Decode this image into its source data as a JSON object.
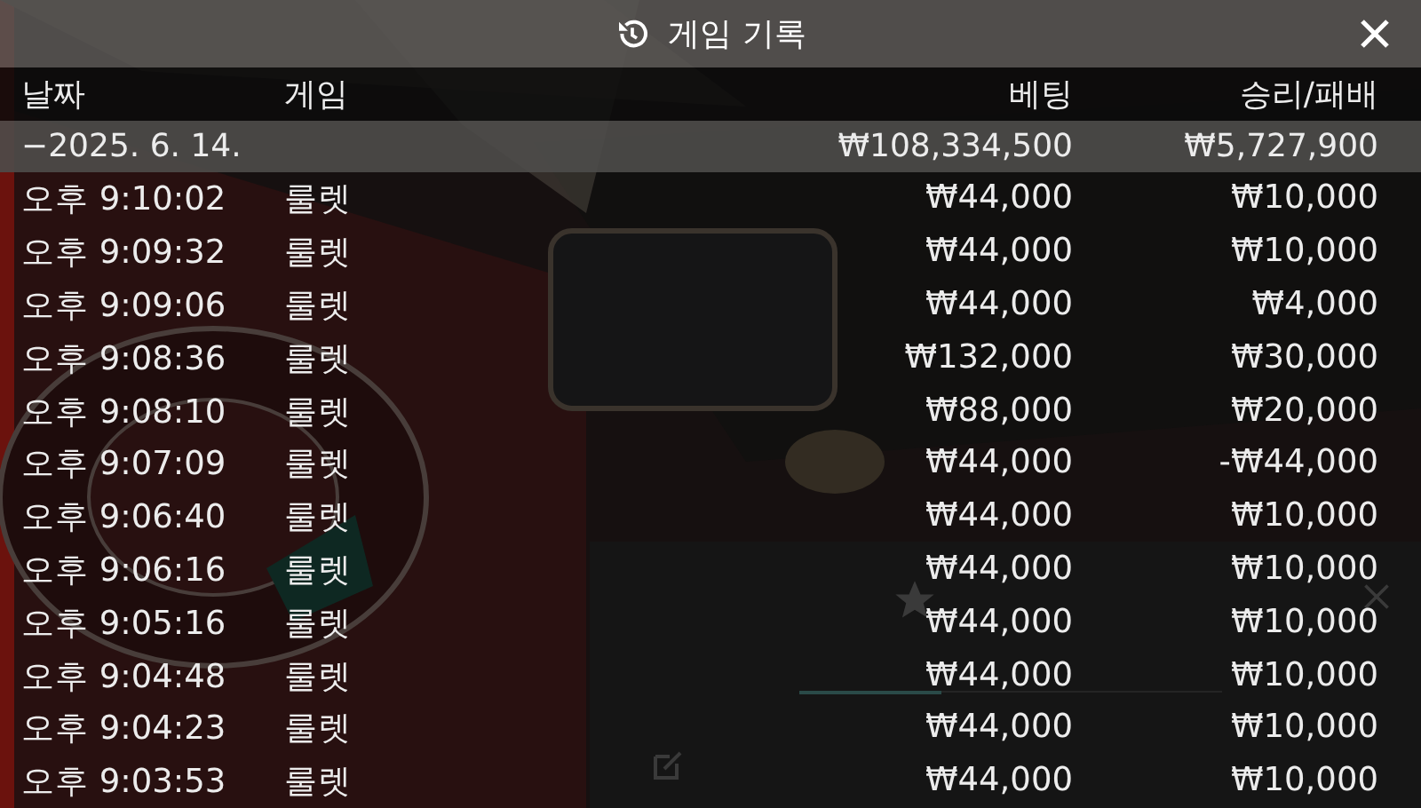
{
  "history": {
    "title": "게임 기록",
    "columns": [
      "날짜",
      "게임",
      "베팅",
      "승리/패배"
    ],
    "summary": {
      "date": "−2025. 6. 14.",
      "bet": "₩108,334,500",
      "result": "₩5,727,900"
    },
    "rows": [
      {
        "time": "오후 9:10:02",
        "game": "룰렛",
        "bet": "₩44,000",
        "result": "₩10,000"
      },
      {
        "time": "오후 9:09:32",
        "game": "룰렛",
        "bet": "₩44,000",
        "result": "₩10,000"
      },
      {
        "time": "오후 9:09:06",
        "game": "룰렛",
        "bet": "₩44,000",
        "result": "₩4,000"
      },
      {
        "time": "오후 9:08:36",
        "game": "룰렛",
        "bet": "₩132,000",
        "result": "₩30,000"
      },
      {
        "time": "오후 9:08:10",
        "game": "룰렛",
        "bet": "₩88,000",
        "result": "₩20,000"
      },
      {
        "time": "오후 9:07:09",
        "game": "룰렛",
        "bet": "₩44,000",
        "result": "-₩44,000"
      },
      {
        "time": "오후 9:06:40",
        "game": "룰렛",
        "bet": "₩44,000",
        "result": "₩10,000"
      },
      {
        "time": "오후 9:06:16",
        "game": "룰렛",
        "bet": "₩44,000",
        "result": "₩10,000"
      },
      {
        "time": "오후 9:05:16",
        "game": "룰렛",
        "bet": "₩44,000",
        "result": "₩10,000"
      },
      {
        "time": "오후 9:04:48",
        "game": "룰렛",
        "bet": "₩44,000",
        "result": "₩10,000"
      },
      {
        "time": "오후 9:04:23",
        "game": "룰렛",
        "bet": "₩44,000",
        "result": "₩10,000"
      },
      {
        "time": "오후 9:03:53",
        "game": "룰렛",
        "bet": "₩44,000",
        "result": "₩10,000"
      }
    ]
  }
}
